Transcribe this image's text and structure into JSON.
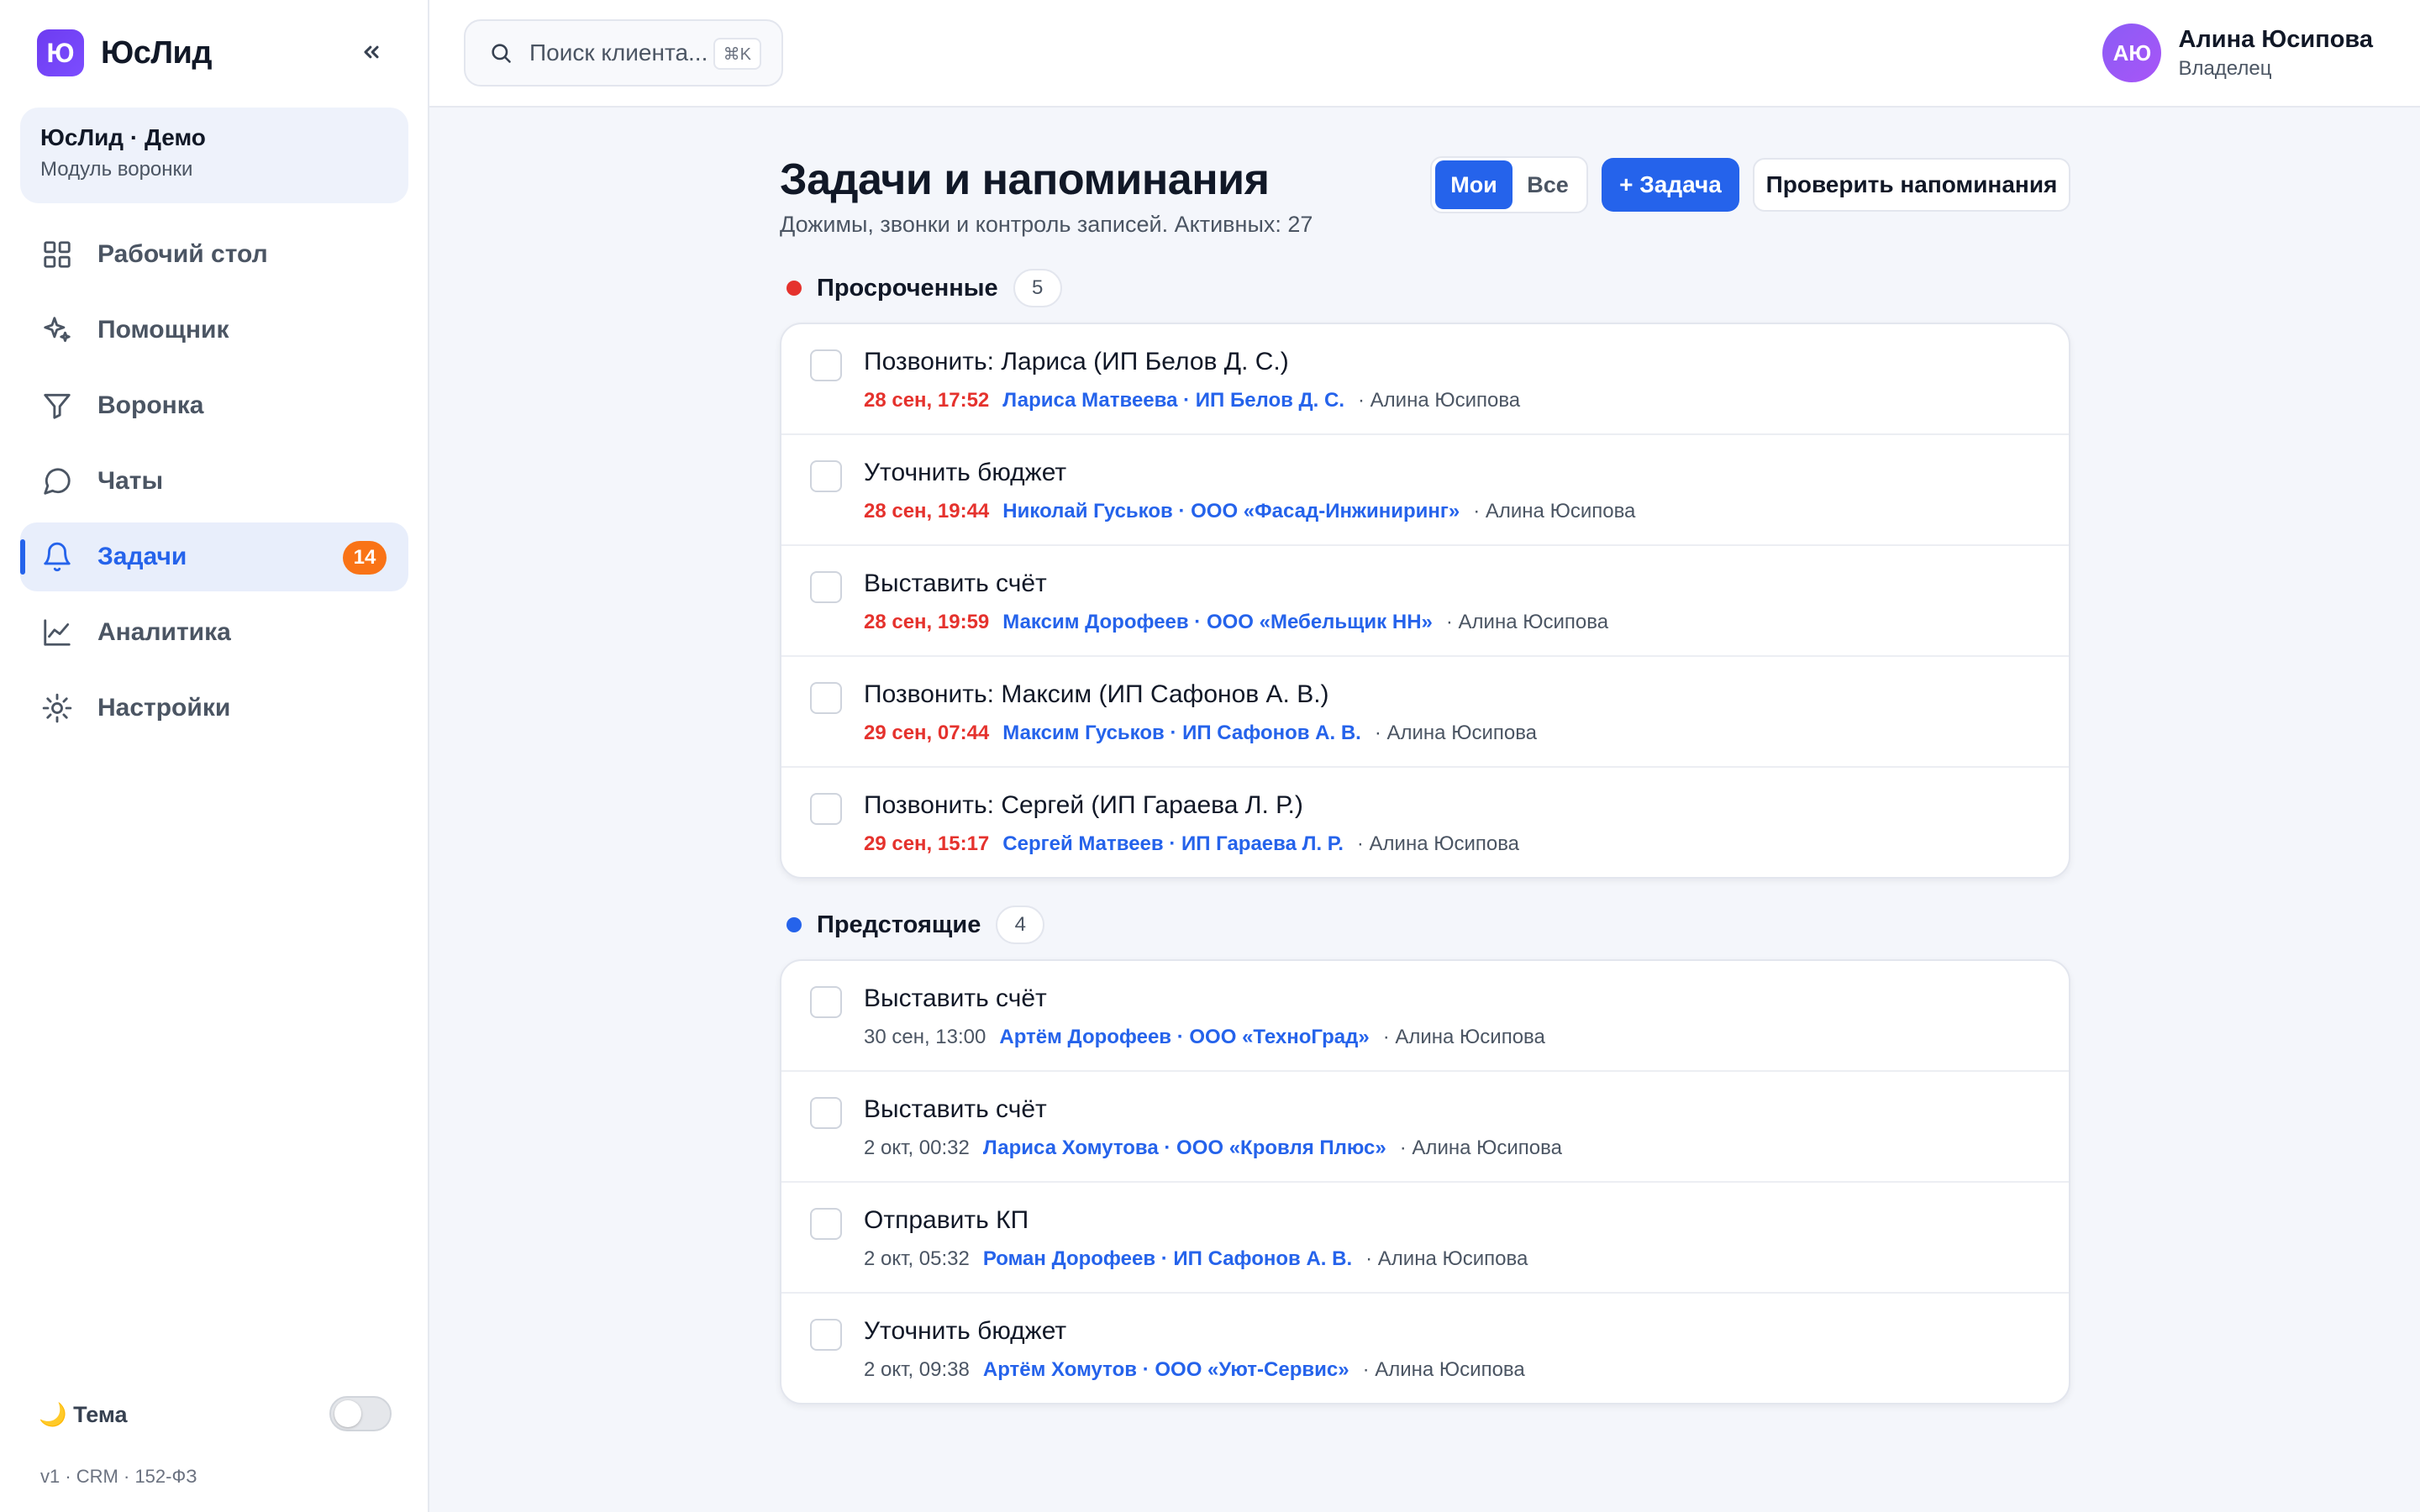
{
  "brand": {
    "logo_letter": "Ю",
    "name": "ЮсЛид"
  },
  "workspace": {
    "name": "ЮсЛид · Демо",
    "subtitle": "Модуль воронки"
  },
  "nav": [
    {
      "label": "Рабочий стол",
      "icon": "grid-icon"
    },
    {
      "label": "Помощник",
      "icon": "sparkle-icon"
    },
    {
      "label": "Воронка",
      "icon": "filter-icon"
    },
    {
      "label": "Чаты",
      "icon": "chat-icon"
    },
    {
      "label": "Задачи",
      "icon": "bell-icon",
      "badge": "14",
      "active": true
    },
    {
      "label": "Аналитика",
      "icon": "chart-icon"
    },
    {
      "label": "Настройки",
      "icon": "gear-icon"
    }
  ],
  "theme": {
    "label": "🌙 Тема",
    "enabled": false
  },
  "version": "v1 · CRM · 152-ФЗ",
  "search": {
    "placeholder": "Поиск клиента...",
    "shortcut": "⌘K"
  },
  "user": {
    "initials": "АЮ",
    "name": "Алина Юсипова",
    "role": "Владелец"
  },
  "page": {
    "title": "Задачи и напоминания",
    "subtitle": "Дожимы, звонки и контроль записей. Активных: 27",
    "filter_mine": "Мои",
    "filter_all": "Все",
    "add_task": "+ Задача",
    "check_reminders": "Проверить напоминания"
  },
  "colors": {
    "accent": "#2563eb",
    "overdue": "#e5322d",
    "badge": "#f97316"
  },
  "sections": [
    {
      "title": "Просроченные",
      "count": "5",
      "dot_color": "#e5322d",
      "overdue": true,
      "tasks": [
        {
          "title": "Позвонить: Лариса (ИП Белов Д. С.)",
          "due": "28 сен, 17:52",
          "link": "Лариса Матвеева · ИП Белов Д. С.",
          "owner": "· Алина Юсипова"
        },
        {
          "title": "Уточнить бюджет",
          "due": "28 сен, 19:44",
          "link": "Николай Гуськов · ООО «Фасад-Инжиниринг»",
          "owner": "· Алина Юсипова"
        },
        {
          "title": "Выставить счёт",
          "due": "28 сен, 19:59",
          "link": "Максим Дорофеев · ООО «Мебельщик НН»",
          "owner": "· Алина Юсипова"
        },
        {
          "title": "Позвонить: Максим (ИП Сафонов А. В.)",
          "due": "29 сен, 07:44",
          "link": "Максим Гуськов · ИП Сафонов А. В.",
          "owner": "· Алина Юсипова"
        },
        {
          "title": "Позвонить: Сергей (ИП Гараева Л. Р.)",
          "due": "29 сен, 15:17",
          "link": "Сергей Матвеев · ИП Гараева Л. Р.",
          "owner": "· Алина Юсипова"
        }
      ]
    },
    {
      "title": "Предстоящие",
      "count": "4",
      "dot_color": "#2563eb",
      "overdue": false,
      "tasks": [
        {
          "title": "Выставить счёт",
          "due": "30 сен, 13:00",
          "link": "Артём Дорофеев · ООО «ТехноГрад»",
          "owner": "· Алина Юсипова"
        },
        {
          "title": "Выставить счёт",
          "due": "2 окт, 00:32",
          "link": "Лариса Хомутова · ООО «Кровля Плюс»",
          "owner": "· Алина Юсипова"
        },
        {
          "title": "Отправить КП",
          "due": "2 окт, 05:32",
          "link": "Роман Дорофеев · ИП Сафонов А. В.",
          "owner": "· Алина Юсипова"
        },
        {
          "title": "Уточнить бюджет",
          "due": "2 окт, 09:38",
          "link": "Артём Хомутов · ООО «Уют-Сервис»",
          "owner": "· Алина Юсипова"
        }
      ]
    }
  ]
}
